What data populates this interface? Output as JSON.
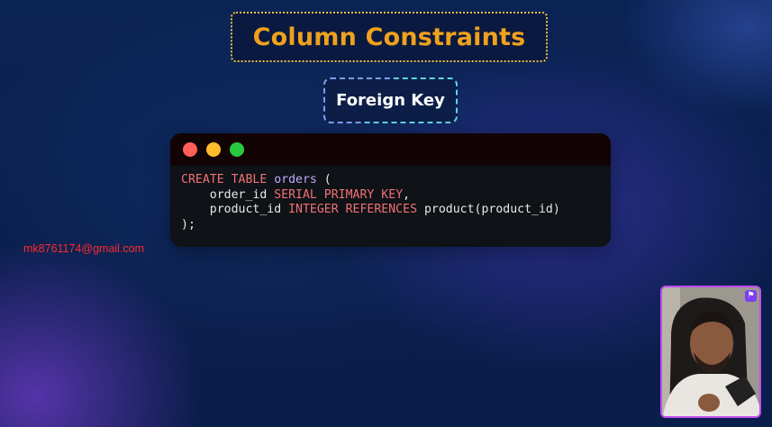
{
  "slide": {
    "title": "Column Constraints",
    "subtitle": "Foreign Key"
  },
  "code_window": {
    "controls": [
      "close-dot",
      "minimize-dot",
      "maximize-dot"
    ],
    "lines": [
      [
        {
          "t": "CREATE TABLE ",
          "c": "kw"
        },
        {
          "t": "orders",
          "c": "name"
        },
        {
          "t": " (",
          "c": "plain"
        }
      ],
      [
        {
          "t": "    order_id ",
          "c": "plain"
        },
        {
          "t": "SERIAL PRIMARY KEY",
          "c": "kw"
        },
        {
          "t": ",",
          "c": "plain"
        }
      ],
      [
        {
          "t": "    product_id ",
          "c": "plain"
        },
        {
          "t": "INTEGER REFERENCES",
          "c": "kw"
        },
        {
          "t": " product(product_id)",
          "c": "plain"
        }
      ],
      [
        {
          "t": ");",
          "c": "plain"
        }
      ]
    ]
  },
  "watermark": {
    "email": "mk8761174@gmail.com"
  },
  "webcam": {
    "badge_icon": "presenter-logo-icon"
  },
  "colors": {
    "title": "#f0a11d",
    "title_border": "#e6c34a",
    "subtitle_border": "#5fd3e8",
    "keyword": "#f07178",
    "identifier": "#c3a6ff",
    "email": "#ff2a2a",
    "webcam_border": "#c04cf0"
  }
}
